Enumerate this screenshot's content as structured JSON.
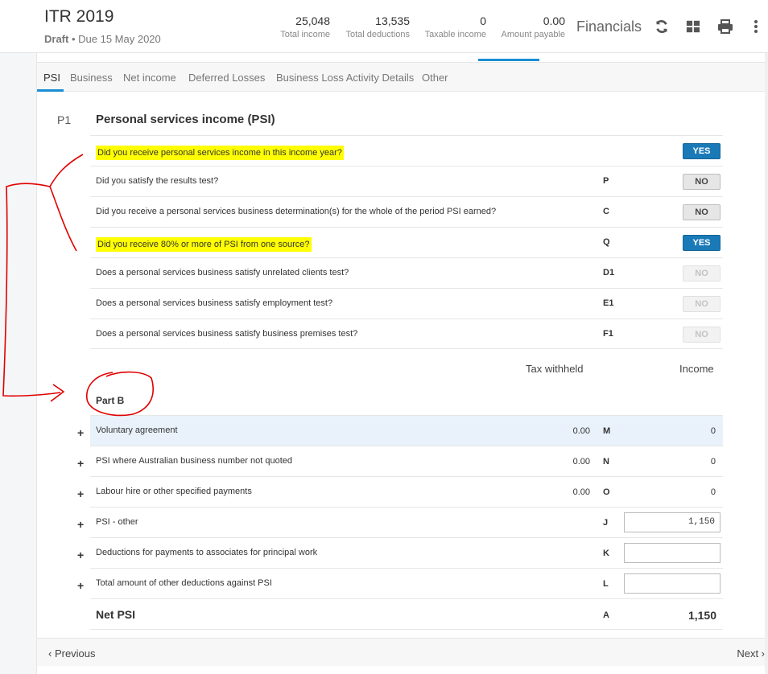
{
  "header": {
    "title": "ITR 2019",
    "status": "Draft",
    "due": "• Due 15 May 2020",
    "stats": [
      {
        "value": "25,048",
        "label": "Total income"
      },
      {
        "value": "13,535",
        "label": "Total deductions"
      },
      {
        "value": "0",
        "label": "Taxable income"
      },
      {
        "value": "0.00",
        "label": "Amount payable"
      }
    ],
    "financials": "Financials",
    "icons": [
      "refresh-icon",
      "grid-icon",
      "print-icon",
      "more-vertical-icon"
    ]
  },
  "tabs": [
    "PSI",
    "Business",
    "Net income",
    "Deferred Losses",
    "Business Loss Activity Details",
    "Other"
  ],
  "active_tab": "PSI",
  "section": {
    "number": "P1",
    "title": "Personal services income (PSI)"
  },
  "questions": [
    {
      "text": "Did you receive personal services income in this income year?",
      "code": "",
      "answer": "YES",
      "highlight": true,
      "state": "yes"
    },
    {
      "text": "Did you satisfy the results test?",
      "code": "P",
      "answer": "NO",
      "highlight": false,
      "state": "no"
    },
    {
      "text": "Did you receive a personal services business determination(s) for the whole of the period PSI earned?",
      "code": "C",
      "answer": "NO",
      "highlight": false,
      "state": "no"
    },
    {
      "text": "Did you receive 80% or more of PSI from one source?",
      "code": "Q",
      "answer": "YES",
      "highlight": true,
      "state": "yes"
    },
    {
      "text": "Does a personal services business satisfy unrelated clients test?",
      "code": "D1",
      "answer": "NO",
      "highlight": false,
      "state": "dis"
    },
    {
      "text": "Does a personal services business satisfy employment test?",
      "code": "E1",
      "answer": "NO",
      "highlight": false,
      "state": "dis"
    },
    {
      "text": "Does a personal services business satisfy business premises test?",
      "code": "F1",
      "answer": "NO",
      "highlight": false,
      "state": "dis"
    }
  ],
  "columns": {
    "tax_withheld": "Tax withheld",
    "income": "Income"
  },
  "part_b": {
    "title": "Part B",
    "rows": [
      {
        "label": "Voluntary agreement",
        "tax_withheld": "0.00",
        "code": "M",
        "income": "0",
        "input": false
      },
      {
        "label": "PSI where Australian business number not quoted",
        "tax_withheld": "0.00",
        "code": "N",
        "income": "0",
        "input": false
      },
      {
        "label": "Labour hire or other specified payments",
        "tax_withheld": "0.00",
        "code": "O",
        "income": "0",
        "input": false
      },
      {
        "label": "PSI - other",
        "tax_withheld": "",
        "code": "J",
        "income": "1,150",
        "input": true
      },
      {
        "label": "Deductions for payments to associates for principal work",
        "tax_withheld": "",
        "code": "K",
        "income": "",
        "input": true
      },
      {
        "label": "Total amount of other deductions against PSI",
        "tax_withheld": "",
        "code": "L",
        "income": "",
        "input": true
      }
    ],
    "plus": "+",
    "net": {
      "label": "Net PSI",
      "code": "A",
      "value": "1,150"
    }
  },
  "footer": {
    "previous": "‹ Previous",
    "next": "Next ›"
  }
}
